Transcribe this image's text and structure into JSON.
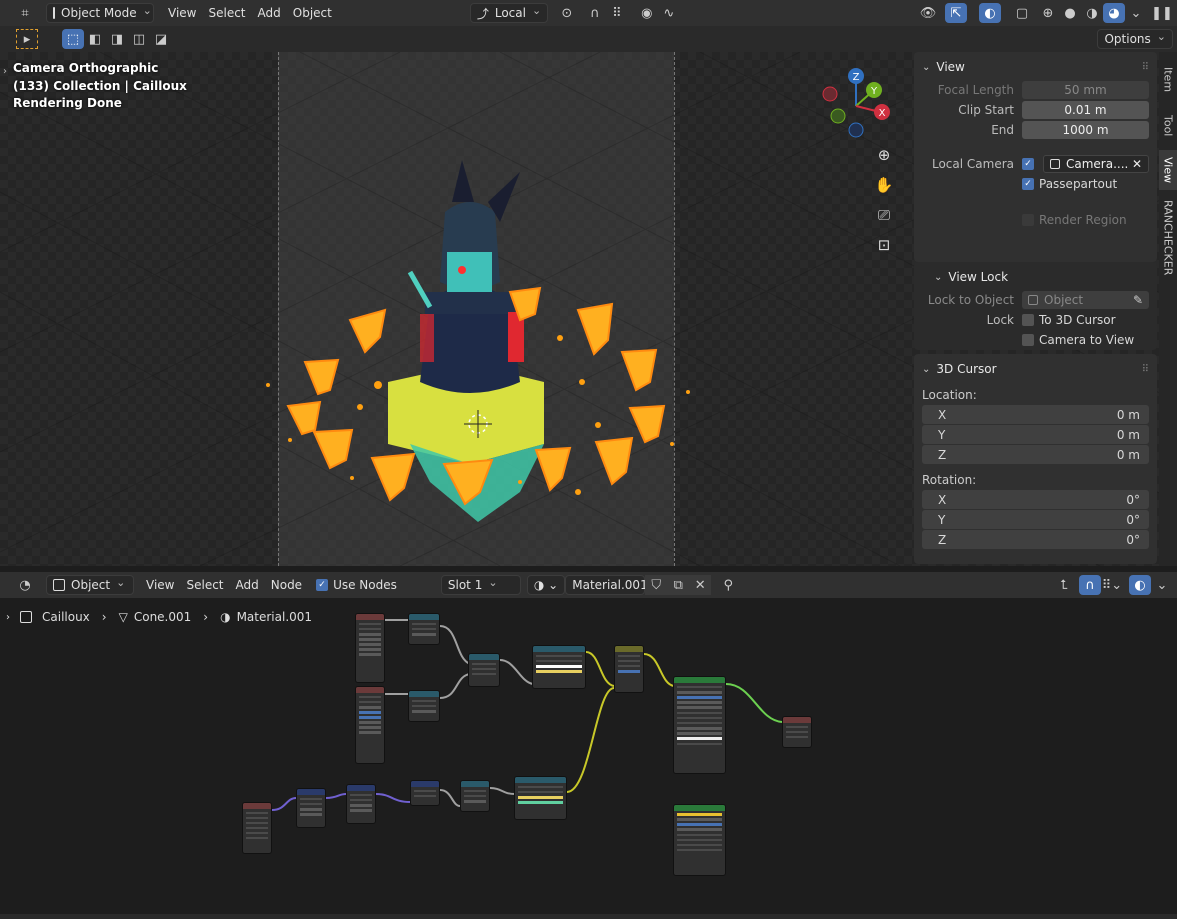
{
  "top_header": {
    "mode": "Object Mode",
    "menus": [
      "View",
      "Select",
      "Add",
      "Object"
    ],
    "transform_orientation": "Local",
    "options_label": "Options"
  },
  "viewport": {
    "info_line1": "Camera Orthographic",
    "info_line2": "(133) Collection | Cailloux",
    "info_line3": "Rendering Done",
    "gizmo": {
      "x": "X",
      "y": "Y",
      "z": "Z"
    }
  },
  "sidebar": {
    "tabs": [
      "Item",
      "Tool",
      "View",
      "RANCHECKER"
    ],
    "view_panel": {
      "title": "View",
      "focal_length_label": "Focal Length",
      "focal_length_value": "50 mm",
      "clip_start_label": "Clip Start",
      "clip_start_value": "0.01 m",
      "clip_end_label": "End",
      "clip_end_value": "1000 m",
      "local_camera_label": "Local Camera",
      "local_camera_value": "Camera....",
      "passepartout_label": "Passepartout",
      "render_region_label": "Render Region"
    },
    "view_lock_panel": {
      "title": "View Lock",
      "lock_to_object_label": "Lock to Object",
      "lock_to_object_placeholder": "Object",
      "lock_label": "Lock",
      "to_3d_cursor_label": "To 3D Cursor",
      "camera_to_view_label": "Camera to View"
    },
    "cursor_panel": {
      "title": "3D Cursor",
      "location_label": "Location:",
      "location": [
        {
          "axis": "X",
          "value": "0 m"
        },
        {
          "axis": "Y",
          "value": "0 m"
        },
        {
          "axis": "Z",
          "value": "0 m"
        }
      ],
      "rotation_label": "Rotation:",
      "rotation": [
        {
          "axis": "X",
          "value": "0°"
        },
        {
          "axis": "Y",
          "value": "0°"
        },
        {
          "axis": "Z",
          "value": "0°"
        }
      ]
    }
  },
  "node_header": {
    "type": "Object",
    "menus": [
      "View",
      "Select",
      "Add",
      "Node"
    ],
    "use_nodes_label": "Use Nodes",
    "slot": "Slot 1",
    "material": "Material.001"
  },
  "breadcrumb": {
    "object": "Cailloux",
    "mesh": "Cone.001",
    "material": "Material.001"
  },
  "colors": {
    "accent": "#4772b3",
    "header_bg": "#303030",
    "panel_bg": "#303030",
    "field_bg": "#545454",
    "crystal": "#ffb020",
    "wire_yellow": "#c8c828",
    "wire_green": "#6cd050",
    "wire_purple": "#7060d0",
    "wire_gray": "#a0a0a0"
  }
}
